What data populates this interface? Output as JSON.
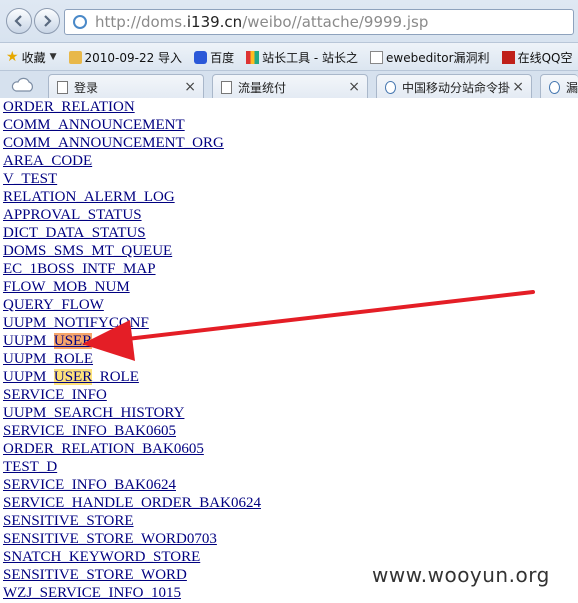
{
  "browser": {
    "url_prefix": "http://doms.",
    "url_host": "i139.cn",
    "url_path": "/weibo//attache/9999.jsp"
  },
  "bookmarks": [
    {
      "label": "收藏",
      "icon": "star-icon"
    },
    {
      "label": "2010-09-22 导入",
      "icon": "folder-icon"
    },
    {
      "label": "百度",
      "icon": "baidu-icon"
    },
    {
      "label": "站长工具 - 站长之",
      "icon": "tool-icon"
    },
    {
      "label": "ewebeditor漏洞利",
      "icon": "doc-icon"
    },
    {
      "label": "在线QQ空",
      "icon": "lu-icon"
    }
  ],
  "tabs": [
    {
      "label": "登录",
      "close": "×"
    },
    {
      "label": "流量统付",
      "close": "×"
    },
    {
      "label": "中国移动分站命令掛",
      "close": "×"
    },
    {
      "label": "漏",
      "close": ""
    }
  ],
  "links": [
    {
      "label": "ORDER_RELATION"
    },
    {
      "label": "COMM_ANNOUNCEMENT"
    },
    {
      "label": "COMM_ANNOUNCEMENT_ORG"
    },
    {
      "label": "AREA_CODE"
    },
    {
      "label": "V_TEST"
    },
    {
      "label": "RELATION_ALERM_LOG"
    },
    {
      "label": "APPROVAL_STATUS"
    },
    {
      "label": "DICT_DATA_STATUS"
    },
    {
      "label": "DOMS_SMS_MT_QUEUE"
    },
    {
      "label": "EC_1BOSS_INTF_MAP"
    },
    {
      "label": "FLOW_MOB_NUM"
    },
    {
      "label": "QUERY_FLOW"
    },
    {
      "label": "UUPM_NOTIFYCONF"
    },
    {
      "label": "UUPM_USER",
      "hl": "USER",
      "hl_style": "orange"
    },
    {
      "label": "UUPM_ROLE"
    },
    {
      "label": "UUPM_USER_ROLE",
      "hl": "USER",
      "hl_style": "yellow"
    },
    {
      "label": "SERVICE_INFO"
    },
    {
      "label": "UUPM_SEARCH_HISTORY"
    },
    {
      "label": "SERVICE_INFO_BAK0605"
    },
    {
      "label": "ORDER_RELATION_BAK0605"
    },
    {
      "label": "TEST_D"
    },
    {
      "label": "SERVICE_INFO_BAK0624"
    },
    {
      "label": "SERVICE_HANDLE_ORDER_BAK0624"
    },
    {
      "label": "SENSITIVE_STORE"
    },
    {
      "label": "SENSITIVE_STORE_WORD0703"
    },
    {
      "label": "SNATCH_KEYWORD_STORE"
    },
    {
      "label": "SENSITIVE_STORE_WORD"
    },
    {
      "label": "WZJ_SERVICE_INFO_1015"
    }
  ],
  "watermark": "www.wooyun.org",
  "colors": {
    "link": "#000080",
    "highlight_yellow": "#fde27a",
    "highlight_orange": "#f6a56a",
    "arrow": "#e41e26"
  }
}
